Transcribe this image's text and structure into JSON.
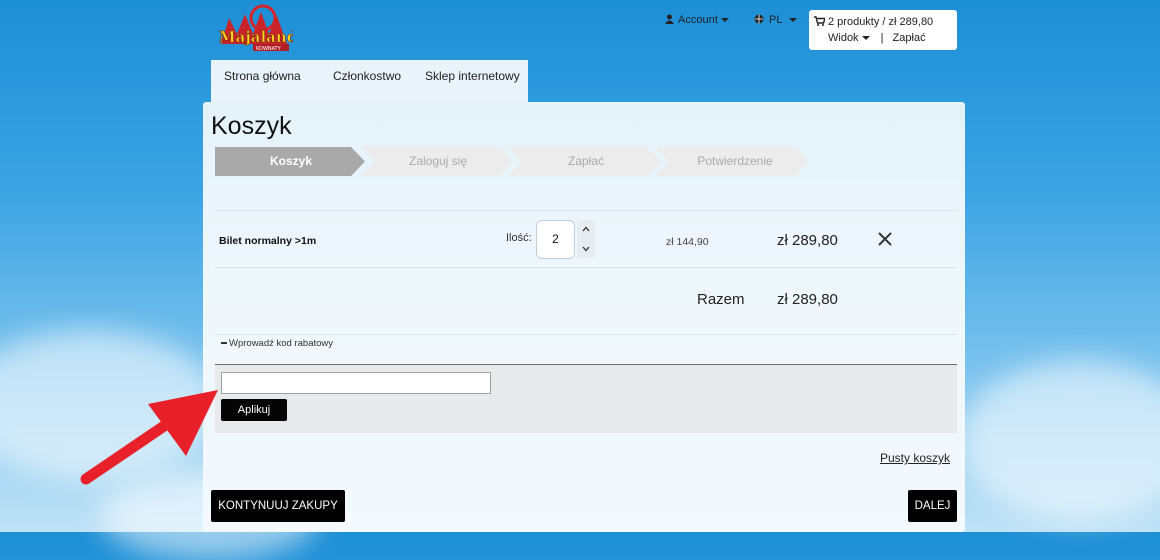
{
  "header": {
    "logo": {
      "text": "Majaland",
      "subtext": "KOWNATY"
    },
    "account_label": "Account",
    "language_label": "PL",
    "cart": {
      "summary": "2 produkty / zł 289,80",
      "view_label": "Widok",
      "separator": "|",
      "pay_label": "Zapłać"
    }
  },
  "nav": {
    "tabs": [
      {
        "label": "Strona główna"
      },
      {
        "label": "Członkostwo"
      },
      {
        "label": "Sklep internetowy"
      }
    ]
  },
  "page": {
    "title": "Koszyk"
  },
  "steps": [
    {
      "label": "Koszyk",
      "active": true
    },
    {
      "label": "Zaloguj się",
      "active": false
    },
    {
      "label": "Zapłać",
      "active": false
    },
    {
      "label": "Potwierdzenie",
      "active": false
    }
  ],
  "cart_items": [
    {
      "name": "Bilet normalny >1m",
      "qty_label": "Ilość:",
      "qty": "2",
      "unit_price": "zł 144,90",
      "total": "zł 289,80"
    }
  ],
  "summary": {
    "label": "Razem",
    "total": "zł 289,80"
  },
  "promo": {
    "toggle_label": "Wprowadź kod rabatowy",
    "input_value": "",
    "apply_label": "Aplikuj"
  },
  "actions": {
    "empty_cart": "Pusty koszyk",
    "continue_label": "KONTYNUUJ ZAKUPY",
    "next_label": "DALEJ"
  },
  "colors": {
    "sky": "#2a98dc",
    "panel": "#e9f4fb",
    "button": "#000000",
    "step_active": "#a9a9a9",
    "step_inactive": "#ececec",
    "arrow": "#e8202a"
  }
}
